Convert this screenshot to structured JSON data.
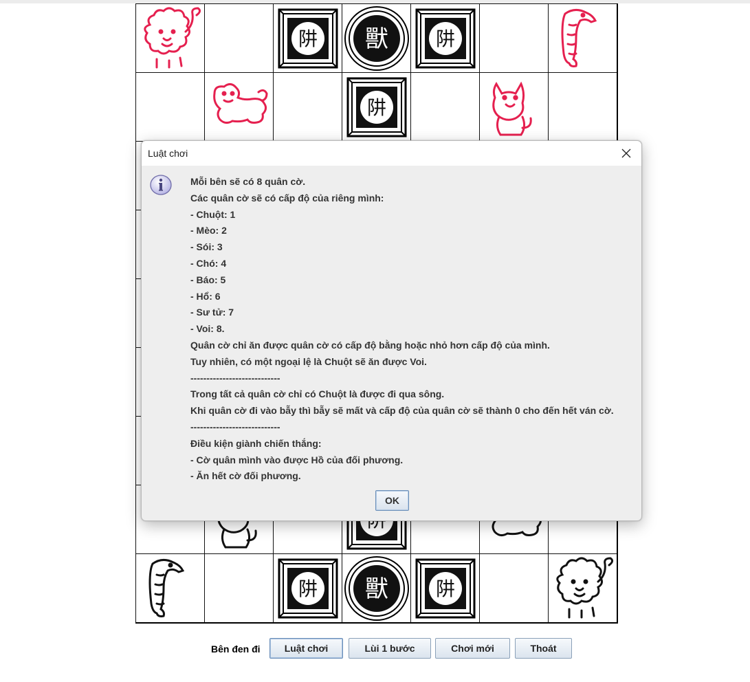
{
  "board": {
    "rows": [
      [
        "lion-red",
        "",
        "trap",
        "den",
        "trap",
        "",
        "tiger-red"
      ],
      [
        "",
        "dog-red",
        "",
        "trap",
        "",
        "cat-red",
        ""
      ],
      [
        "",
        "",
        "",
        "",
        "",
        "",
        ""
      ],
      [
        "",
        "",
        "",
        "",
        "",
        "",
        ""
      ],
      [
        "",
        "",
        "",
        "",
        "",
        "",
        ""
      ],
      [
        "",
        "",
        "",
        "",
        "",
        "",
        ""
      ],
      [
        "",
        "",
        "",
        "",
        "",
        "",
        ""
      ],
      [
        "",
        "cat-black",
        "",
        "trap",
        "",
        "dog-black",
        ""
      ],
      [
        "tiger-black",
        "",
        "trap",
        "den",
        "trap",
        "",
        "lion-black"
      ]
    ],
    "colors": {
      "red_piece": "#e5204f",
      "black_piece": "#111111"
    }
  },
  "controls": {
    "turn_label": "Bên đen đi",
    "rules_button": "Luật chơi",
    "undo_button": "Lùi 1 bước",
    "new_game_button": "Chơi mới",
    "exit_button": "Thoát"
  },
  "dialog": {
    "title": "Luật chơi",
    "icon": "info-icon",
    "lines": [
      "Mỗi bên sẽ có 8 quân cờ.",
      "Các quân cờ sẽ có cấp độ của riêng mình:",
      "- Chuột: 1",
      "- Mèo: 2",
      "- Sói: 3",
      "- Chó: 4",
      "- Báo: 5",
      "- Hổ: 6",
      "- Sư tử: 7",
      "- Voi: 8.",
      "Quân cờ chỉ ăn được quân cờ có cấp độ bằng hoặc nhỏ hơn cấp độ của mình.",
      "Tuy nhiên, có một ngoại lệ là Chuột sẽ ăn được Voi.",
      "----------------------------",
      "Trong tất cả quân cờ chỉ có Chuột là được đi qua sông.",
      "Khi quân cờ đi vào bẫy thì bẫy sẽ mất và cấp độ của quân cờ sẽ thành 0 cho đến hết ván cờ.",
      "----------------------------",
      "Điều kiện giành chiến thắng:",
      "- Cờ quân mình vào được Hồ của đối phương.",
      "- Ăn hết cờ đối phương."
    ],
    "ok_button": "OK"
  }
}
